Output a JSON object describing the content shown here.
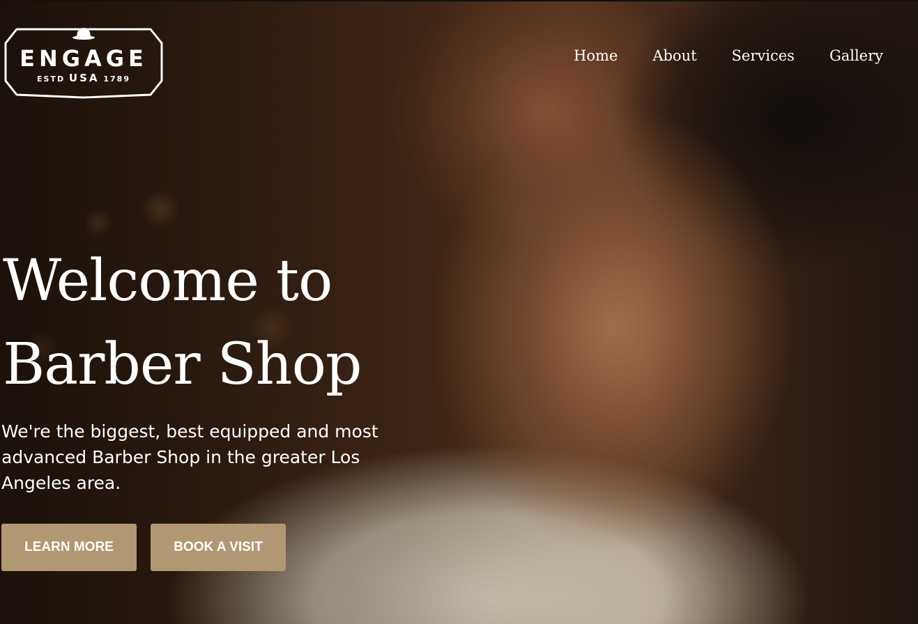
{
  "brand": {
    "name": "ENGAGE",
    "sub_left": "ESTD",
    "sub_mid": "USA",
    "sub_right": "1789",
    "icon": "bowler-hat-icon"
  },
  "nav": {
    "items": [
      {
        "label": "Home"
      },
      {
        "label": "About"
      },
      {
        "label": "Services"
      },
      {
        "label": "Gallery"
      }
    ]
  },
  "hero": {
    "title_line1": "Welcome to",
    "title_line2": "Barber Shop",
    "description": "We're the biggest, best equipped and most advanced Barber Shop in the greater Los Angeles area.",
    "learn_more_label": "LEARN MORE",
    "book_label": "BOOK A VISIT"
  },
  "colors": {
    "accent": "#b09872",
    "text": "#ffffff"
  }
}
